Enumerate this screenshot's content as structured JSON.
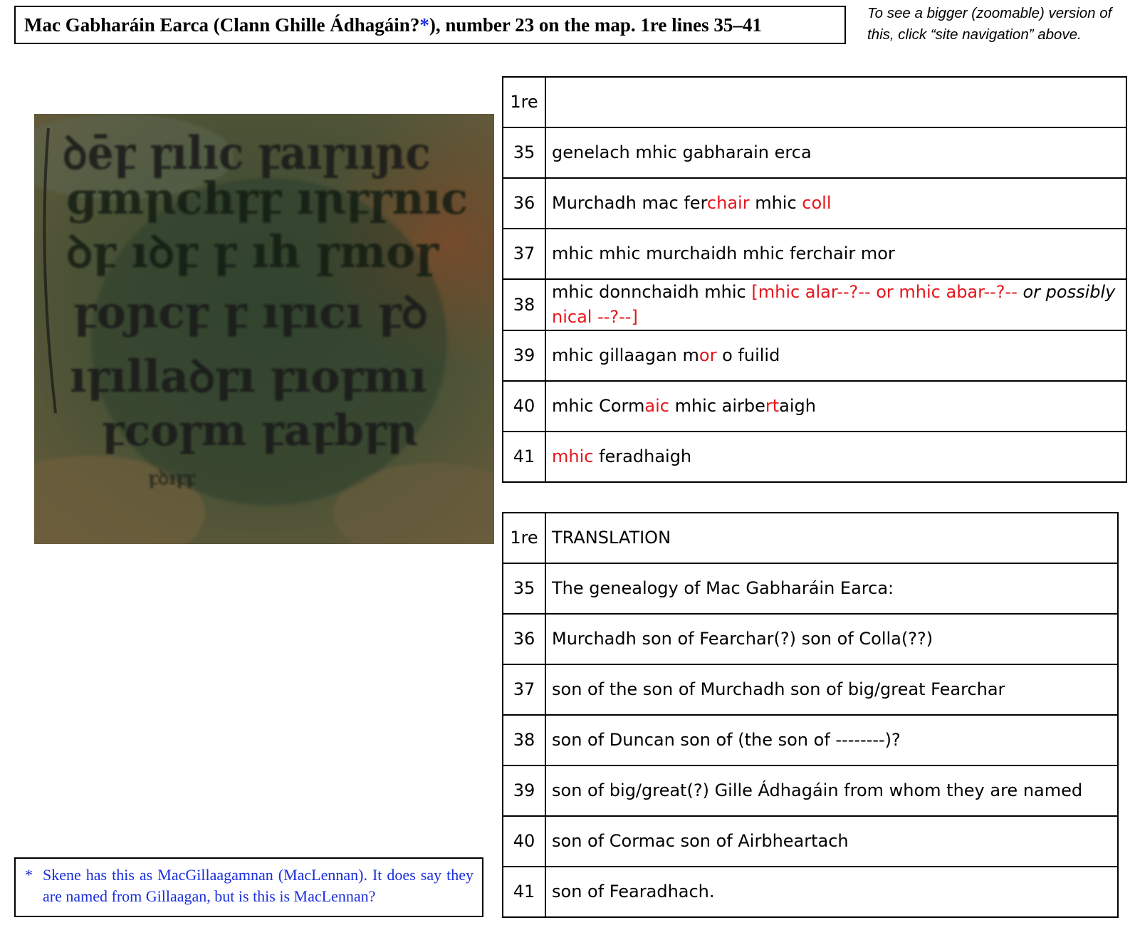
{
  "header": {
    "title_main": "Mac Gabharáin Earca (Clann Ghille Ádhagáin?",
    "title_star": "*",
    "title_rest": "), number 23 on the map. 1re lines 35–41",
    "nav_note": "To see a bigger (zoomable) version of this, click “site navigation” above."
  },
  "image": {
    "description_icon": "manuscript-image"
  },
  "irish_table": {
    "header_num": "1re",
    "header_text": "",
    "rows": [
      {
        "num": "35",
        "parts": [
          {
            "t": "genelach mhic gabharain erca"
          }
        ]
      },
      {
        "num": "36",
        "parts": [
          {
            "t": "Murchadh mac fer"
          },
          {
            "t": "chair",
            "red": true
          },
          {
            "t": " mhic "
          },
          {
            "t": "coll",
            "red": true
          }
        ]
      },
      {
        "num": "37",
        "parts": [
          {
            "t": "mhic mhic murchaidh mhic ferchair mor"
          }
        ]
      },
      {
        "num": "38",
        "parts": [
          {
            "t": "mhic donnchaidh mhic "
          },
          {
            "t": "[mhic alar--?-- or mhic abar--?-- ",
            "red": true
          },
          {
            "t": "or possibly",
            "italic": true
          },
          {
            "t": " nical --?--]",
            "red": true
          }
        ]
      },
      {
        "num": "39",
        "parts": [
          {
            "t": "mhic gillaagan m"
          },
          {
            "t": "or",
            "red": true
          },
          {
            "t": " o fuilid"
          }
        ]
      },
      {
        "num": "40",
        "parts": [
          {
            "t": "mhic Corm"
          },
          {
            "t": "aic",
            "red": true
          },
          {
            "t": " mhic airbe"
          },
          {
            "t": "rt",
            "red": true
          },
          {
            "t": "aigh"
          }
        ]
      },
      {
        "num": "41",
        "parts": [
          {
            "t": "mhic",
            "red": true
          },
          {
            "t": " feradhaigh"
          }
        ]
      }
    ]
  },
  "translation_table": {
    "header_num": "1re",
    "header_text": "TRANSLATION",
    "rows": [
      {
        "num": "35",
        "text": "The genealogy of Mac Gabharáin Earca:"
      },
      {
        "num": "36",
        "text": "Murchadh son of Fearchar(?) son of Colla(??)"
      },
      {
        "num": "37",
        "text": "son of the son of Murchadh son of big/great Fearchar"
      },
      {
        "num": "38",
        "text": "son of Duncan son of (the son of --------)?"
      },
      {
        "num": "39",
        "text": "son of big/great(?) Gille Ádhagáin from whom they are named"
      },
      {
        "num": "40",
        "text": "son of Cormac son of Airbheartach"
      },
      {
        "num": "41",
        "text": "son of Fearadhach."
      }
    ]
  },
  "footnote": {
    "star": "*",
    "text": "Skene has this as MacGillaagamnan (MacLennan). It does say they are named from Gillaagan, but is this is MacLennan?"
  },
  "colors": {
    "red": "#e6151b",
    "blue": "#1a2ee0"
  }
}
